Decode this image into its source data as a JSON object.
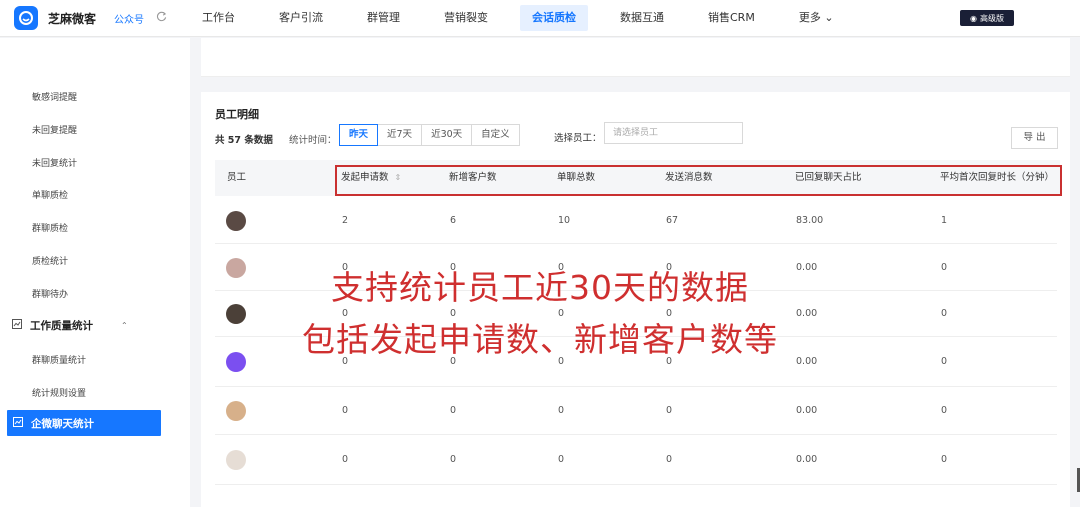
{
  "app": {
    "name": "芝麻微客",
    "account": "公众号"
  },
  "nav": {
    "items": [
      "工作台",
      "客户引流",
      "群管理",
      "营销裂变",
      "会话质检",
      "数据互通",
      "销售CRM",
      "更多"
    ],
    "active_index": 4,
    "badge": "高级版"
  },
  "sidebar": {
    "items": [
      "敏感词提醒",
      "未回复提醒",
      "未回复统计",
      "单聊质检",
      "群聊质检",
      "质检统计",
      "群聊待办"
    ],
    "group_label": "工作质量统计",
    "group_items": [
      "群聊质量统计",
      "统计规则设置"
    ],
    "active_label": "企微聊天统计"
  },
  "main": {
    "section_title": "员工明细",
    "count_text": "共 57 条数据",
    "time_label": "统计时间：",
    "time_options": [
      "昨天",
      "近7天",
      "近30天",
      "自定义"
    ],
    "time_selected_index": 0,
    "employee_label": "选择员工：",
    "employee_placeholder": "请选择员工",
    "export_label": "导 出"
  },
  "table": {
    "headers": [
      "员工",
      "发起申请数",
      "新增客户数",
      "单聊总数",
      "发送消息数",
      "已回复聊天占比",
      "平均首次回复时长（分钟）"
    ],
    "rows": [
      {
        "avatar_color": "#5a4a44",
        "cells": [
          "2",
          "6",
          "10",
          "67",
          "83.00",
          "1"
        ]
      },
      {
        "avatar_color": "#c9a7a0",
        "cells": [
          "0",
          "0",
          "0",
          "0",
          "0.00",
          "0"
        ]
      },
      {
        "avatar_color": "#4b4038",
        "cells": [
          "0",
          "0",
          "0",
          "0",
          "0.00",
          "0"
        ]
      },
      {
        "avatar_color": "#7b4ff0",
        "cells": [
          "0",
          "0",
          "0",
          "0",
          "0.00",
          "0"
        ]
      },
      {
        "avatar_color": "#d7b08a",
        "cells": [
          "0",
          "0",
          "0",
          "0",
          "0.00",
          "0"
        ]
      },
      {
        "avatar_color": "#e6ddd5",
        "cells": [
          "0",
          "0",
          "0",
          "0",
          "0.00",
          "0"
        ]
      }
    ]
  },
  "overlay": {
    "line1": "支持统计员工近30天的数据",
    "line2": "包括发起申请数、新增客户数等"
  },
  "colors": {
    "accent": "#1677ff",
    "highlight": "#c93030",
    "overlay_text": "#cf2f2f"
  }
}
